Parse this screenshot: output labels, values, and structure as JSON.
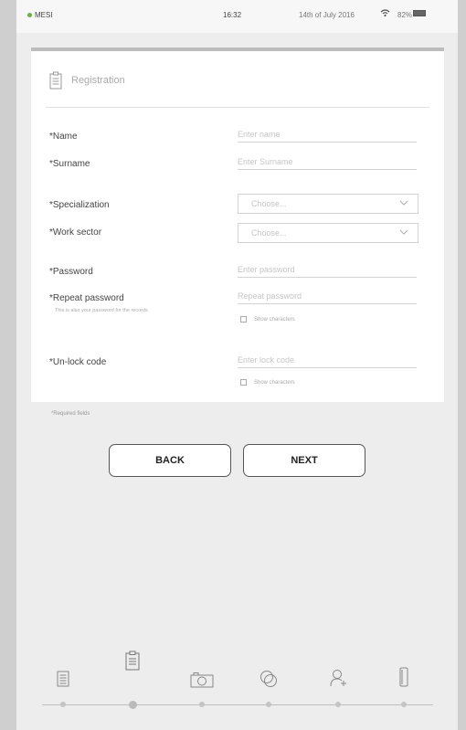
{
  "status_bar": {
    "carrier": "MESI",
    "time": "16:32",
    "date": "14th of July 2016",
    "battery_pct": "82%"
  },
  "form": {
    "title": "Registration",
    "name": {
      "label": "*Name",
      "placeholder": "Enter name"
    },
    "surname": {
      "label": "*Surname",
      "placeholder": "Enter Surname"
    },
    "specialization": {
      "label": "*Specialization",
      "value": "Choose..."
    },
    "work_sector": {
      "label": "*Work sector",
      "value": "Choose..."
    },
    "password": {
      "label": "*Password",
      "placeholder": "Enter password"
    },
    "repeat_password": {
      "label": "*Repeat password",
      "hint": "This is also your password for the records",
      "placeholder": "Repeat password",
      "show_characters": "Show characters"
    },
    "unlock_code": {
      "label": "*Un-lock code",
      "placeholder": "Enter lock code",
      "show_characters": "Show characters"
    },
    "required_note": "*Required fields"
  },
  "buttons": {
    "back": "BACK",
    "next": "NEXT"
  },
  "nav": {
    "steps": [
      "document-icon",
      "clipboard-icon",
      "camera-icon",
      "overlap-circles-icon",
      "user-add-icon",
      "tablet-icon"
    ],
    "active_step": 2
  }
}
